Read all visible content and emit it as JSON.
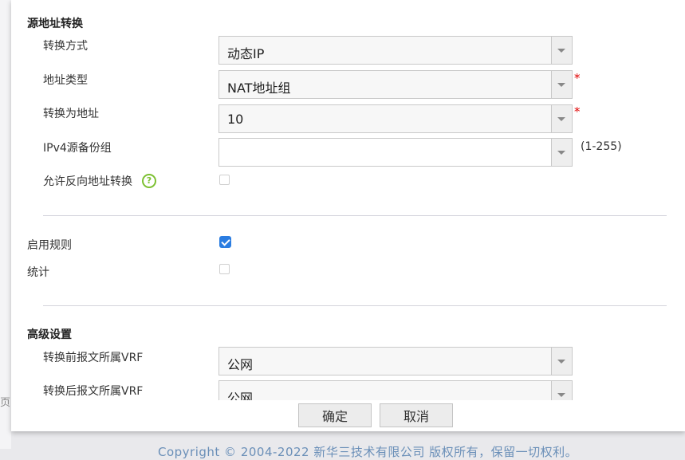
{
  "background": {
    "page_stub_text": "页",
    "footer": "Copyright © 2004-2022 新华三技术有限公司 版权所有，保留一切权利。"
  },
  "source_nat": {
    "title": "源地址转换",
    "mode": {
      "label": "转换方式",
      "value": "动态IP"
    },
    "addr_type": {
      "label": "地址类型",
      "value": "NAT地址组",
      "required": "*"
    },
    "translate_to": {
      "label": "转换为地址",
      "value": "10",
      "required": "*"
    },
    "ipv4_backup": {
      "label": "IPv4源备份组",
      "value": "",
      "hint": "(1-255)"
    },
    "allow_reverse": {
      "label": "允许反向地址转换",
      "help_icon": "?",
      "checked": false
    }
  },
  "enable_rule": {
    "label": "启用规则",
    "checked": true
  },
  "statistics": {
    "label": "统计",
    "checked": false
  },
  "advanced": {
    "title": "高级设置",
    "vrf_before": {
      "label": "转换前报文所属VRF",
      "value": "公网"
    },
    "vrf_after": {
      "label": "转换后报文所属VRF",
      "value": "公网"
    }
  },
  "buttons": {
    "ok": "确定",
    "cancel": "取消"
  },
  "colors": {
    "accent": "#2b7de1",
    "required": "#e00000",
    "help": "#7cc031"
  }
}
